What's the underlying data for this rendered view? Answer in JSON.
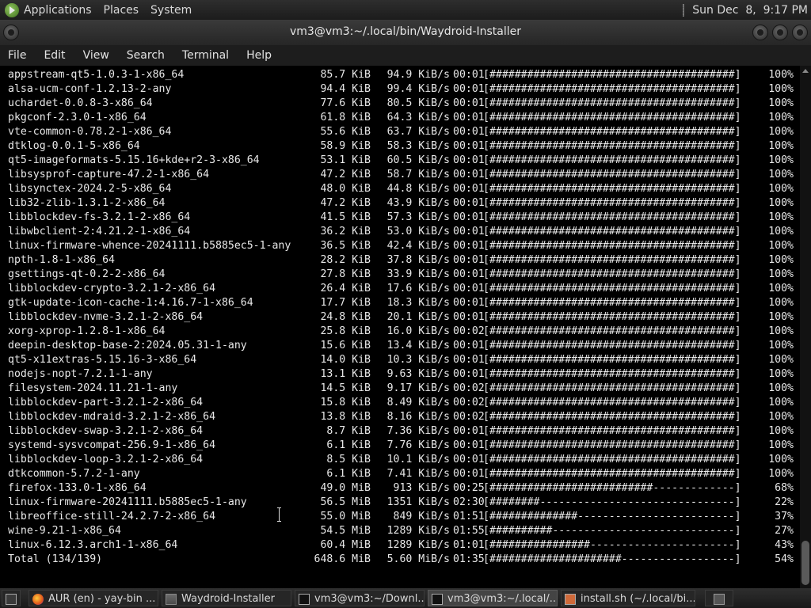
{
  "top_panel": {
    "menus": [
      "Applications",
      "Places",
      "System"
    ],
    "clock": "Sun Dec  8,  9:17 PM"
  },
  "window": {
    "title": "vm3@vm3:~/.local/bin/Waydroid-Installer"
  },
  "menubar": [
    "File",
    "Edit",
    "View",
    "Search",
    "Terminal",
    "Help"
  ],
  "terminal_rows": [
    {
      "name": "appstream-qt5-1.0.3-1-x86_64",
      "size": "85.7 KiB",
      "rate": "94.9 KiB/s",
      "time": "00:01",
      "bar": "[#######################################]",
      "pct": "100%"
    },
    {
      "name": "alsa-ucm-conf-1.2.13-2-any",
      "size": "94.4 KiB",
      "rate": "99.4 KiB/s",
      "time": "00:01",
      "bar": "[#######################################]",
      "pct": "100%"
    },
    {
      "name": "uchardet-0.0.8-3-x86_64",
      "size": "77.6 KiB",
      "rate": "80.5 KiB/s",
      "time": "00:01",
      "bar": "[#######################################]",
      "pct": "100%"
    },
    {
      "name": "pkgconf-2.3.0-1-x86_64",
      "size": "61.8 KiB",
      "rate": "64.3 KiB/s",
      "time": "00:01",
      "bar": "[#######################################]",
      "pct": "100%"
    },
    {
      "name": "vte-common-0.78.2-1-x86_64",
      "size": "55.6 KiB",
      "rate": "63.7 KiB/s",
      "time": "00:01",
      "bar": "[#######################################]",
      "pct": "100%"
    },
    {
      "name": "dtklog-0.0.1-5-x86_64",
      "size": "58.9 KiB",
      "rate": "58.3 KiB/s",
      "time": "00:01",
      "bar": "[#######################################]",
      "pct": "100%"
    },
    {
      "name": "qt5-imageformats-5.15.16+kde+r2-3-x86_64",
      "size": "53.1 KiB",
      "rate": "60.5 KiB/s",
      "time": "00:01",
      "bar": "[#######################################]",
      "pct": "100%"
    },
    {
      "name": "libsysprof-capture-47.2-1-x86_64",
      "size": "47.2 KiB",
      "rate": "58.7 KiB/s",
      "time": "00:01",
      "bar": "[#######################################]",
      "pct": "100%"
    },
    {
      "name": "libsynctex-2024.2-5-x86_64",
      "size": "48.0 KiB",
      "rate": "44.8 KiB/s",
      "time": "00:01",
      "bar": "[#######################################]",
      "pct": "100%"
    },
    {
      "name": "lib32-zlib-1.3.1-2-x86_64",
      "size": "47.2 KiB",
      "rate": "43.9 KiB/s",
      "time": "00:01",
      "bar": "[#######################################]",
      "pct": "100%"
    },
    {
      "name": "libblockdev-fs-3.2.1-2-x86_64",
      "size": "41.5 KiB",
      "rate": "57.3 KiB/s",
      "time": "00:01",
      "bar": "[#######################################]",
      "pct": "100%"
    },
    {
      "name": "libwbclient-2:4.21.2-1-x86_64",
      "size": "36.2 KiB",
      "rate": "53.0 KiB/s",
      "time": "00:01",
      "bar": "[#######################################]",
      "pct": "100%"
    },
    {
      "name": "linux-firmware-whence-20241111.b5885ec5-1-any",
      "size": "36.5 KiB",
      "rate": "42.4 KiB/s",
      "time": "00:01",
      "bar": "[#######################################]",
      "pct": "100%"
    },
    {
      "name": "npth-1.8-1-x86_64",
      "size": "28.2 KiB",
      "rate": "37.8 KiB/s",
      "time": "00:01",
      "bar": "[#######################################]",
      "pct": "100%"
    },
    {
      "name": "gsettings-qt-0.2-2-x86_64",
      "size": "27.8 KiB",
      "rate": "33.9 KiB/s",
      "time": "00:01",
      "bar": "[#######################################]",
      "pct": "100%"
    },
    {
      "name": "libblockdev-crypto-3.2.1-2-x86_64",
      "size": "26.4 KiB",
      "rate": "17.6 KiB/s",
      "time": "00:01",
      "bar": "[#######################################]",
      "pct": "100%"
    },
    {
      "name": "gtk-update-icon-cache-1:4.16.7-1-x86_64",
      "size": "17.7 KiB",
      "rate": "18.3 KiB/s",
      "time": "00:01",
      "bar": "[#######################################]",
      "pct": "100%"
    },
    {
      "name": "libblockdev-nvme-3.2.1-2-x86_64",
      "size": "24.8 KiB",
      "rate": "20.1 KiB/s",
      "time": "00:01",
      "bar": "[#######################################]",
      "pct": "100%"
    },
    {
      "name": "xorg-xprop-1.2.8-1-x86_64",
      "size": "25.8 KiB",
      "rate": "16.0 KiB/s",
      "time": "00:02",
      "bar": "[#######################################]",
      "pct": "100%"
    },
    {
      "name": "deepin-desktop-base-2:2024.05.31-1-any",
      "size": "15.6 KiB",
      "rate": "13.4 KiB/s",
      "time": "00:01",
      "bar": "[#######################################]",
      "pct": "100%"
    },
    {
      "name": "qt5-x11extras-5.15.16-3-x86_64",
      "size": "14.0 KiB",
      "rate": "10.3 KiB/s",
      "time": "00:01",
      "bar": "[#######################################]",
      "pct": "100%"
    },
    {
      "name": "nodejs-nopt-7.2.1-1-any",
      "size": "13.1 KiB",
      "rate": "9.63 KiB/s",
      "time": "00:01",
      "bar": "[#######################################]",
      "pct": "100%"
    },
    {
      "name": "filesystem-2024.11.21-1-any",
      "size": "14.5 KiB",
      "rate": "9.17 KiB/s",
      "time": "00:02",
      "bar": "[#######################################]",
      "pct": "100%"
    },
    {
      "name": "libblockdev-part-3.2.1-2-x86_64",
      "size": "15.8 KiB",
      "rate": "8.49 KiB/s",
      "time": "00:02",
      "bar": "[#######################################]",
      "pct": "100%"
    },
    {
      "name": "libblockdev-mdraid-3.2.1-2-x86_64",
      "size": "13.8 KiB",
      "rate": "8.16 KiB/s",
      "time": "00:02",
      "bar": "[#######################################]",
      "pct": "100%"
    },
    {
      "name": "libblockdev-swap-3.2.1-2-x86_64",
      "size": "8.7 KiB",
      "rate": "7.36 KiB/s",
      "time": "00:01",
      "bar": "[#######################################]",
      "pct": "100%"
    },
    {
      "name": "systemd-sysvcompat-256.9-1-x86_64",
      "size": "6.1 KiB",
      "rate": "7.76 KiB/s",
      "time": "00:01",
      "bar": "[#######################################]",
      "pct": "100%"
    },
    {
      "name": "libblockdev-loop-3.2.1-2-x86_64",
      "size": "8.5 KiB",
      "rate": "10.1 KiB/s",
      "time": "00:01",
      "bar": "[#######################################]",
      "pct": "100%"
    },
    {
      "name": "dtkcommon-5.7.2-1-any",
      "size": "6.1 KiB",
      "rate": "7.41 KiB/s",
      "time": "00:01",
      "bar": "[#######################################]",
      "pct": "100%"
    },
    {
      "name": "firefox-133.0-1-x86_64",
      "size": "49.0 MiB",
      "rate": "913 KiB/s",
      "time": "00:25",
      "bar": "[##########################-------------]",
      "pct": "68%"
    },
    {
      "name": "linux-firmware-20241111.b5885ec5-1-any",
      "size": "56.5 MiB",
      "rate": "1351 KiB/s",
      "time": "02:30",
      "bar": "[########-------------------------------]",
      "pct": "22%"
    },
    {
      "name": "libreoffice-still-24.2.7-2-x86_64",
      "size": "55.0 MiB",
      "rate": "849 KiB/s",
      "time": "01:51",
      "bar": "[##############-------------------------]",
      "pct": "37%"
    },
    {
      "name": "wine-9.21-1-x86_64",
      "size": "54.5 MiB",
      "rate": "1289 KiB/s",
      "time": "01:55",
      "bar": "[##########-----------------------------]",
      "pct": "27%"
    },
    {
      "name": "linux-6.12.3.arch1-1-x86_64",
      "size": "60.4 MiB",
      "rate": "1289 KiB/s",
      "time": "01:01",
      "bar": "[################-----------------------]",
      "pct": "43%"
    },
    {
      "name": "Total (134/139)",
      "size": "648.6 MiB",
      "rate": "5.60 MiB/s",
      "time": "01:35",
      "bar": "[#####################------------------]",
      "pct": "54%"
    }
  ],
  "taskbar": {
    "tasks": [
      {
        "label": "AUR (en) - yay-bin ..."
      },
      {
        "label": "Waydroid-Installer"
      },
      {
        "label": "vm3@vm3:~/Downl..."
      },
      {
        "label": "vm3@vm3:~/.local/..."
      },
      {
        "label": "install.sh (~/.local/bi..."
      }
    ]
  }
}
